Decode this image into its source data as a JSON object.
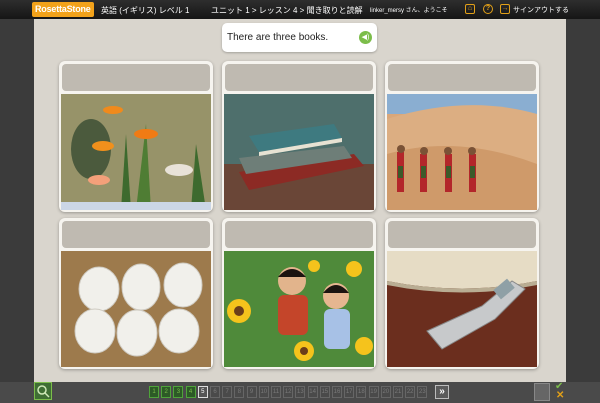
{
  "topbar": {
    "logo": "RosettaStone",
    "course": "英語 (イギリス) レベル 1",
    "unit": "ユニット 1 > レッスン 4 > 聞き取りと読解",
    "user": "linker_mersy さん、ようこそ",
    "home_icon": "home-icon",
    "help_icon": "help-icon",
    "help_glyph": "?",
    "signout_icon": "exit-icon",
    "signout": "サインアウトする"
  },
  "prompt": {
    "text": "There are three books.",
    "speaker_icon": "speaker-icon"
  },
  "cards": [
    {
      "image": "goldfish aquarium"
    },
    {
      "image": "three books"
    },
    {
      "image": "three women in desert"
    },
    {
      "image": "six eggs"
    },
    {
      "image": "two children in sunflowers"
    },
    {
      "image": "mobile phone and book"
    }
  ],
  "navigation": {
    "pages": [
      "1",
      "2",
      "3",
      "4",
      "5",
      "6",
      "7",
      "8",
      "9",
      "10",
      "11",
      "12",
      "13",
      "14",
      "15",
      "16",
      "17",
      "18",
      "19",
      "20",
      "21",
      "22",
      "23"
    ],
    "completed": 4,
    "current": "5",
    "next_label": "»"
  },
  "colors": {
    "accent": "#f2a21a",
    "done": "#7cbd4a",
    "background": "#d9d5cd"
  }
}
